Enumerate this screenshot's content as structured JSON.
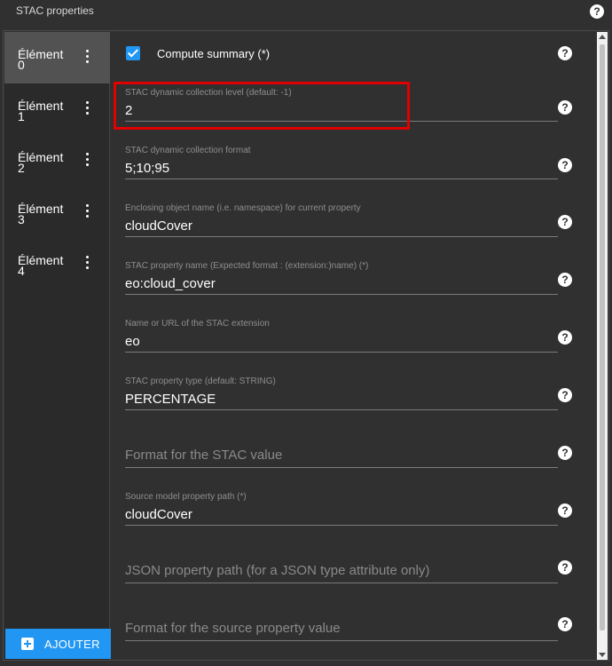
{
  "window": {
    "title": "STAC properties",
    "help_glyph": "?"
  },
  "sidebar": {
    "items": [
      {
        "label": "Élément\n0",
        "active": true
      },
      {
        "label": "Élément\n1",
        "active": false
      },
      {
        "label": "Élément\n2",
        "active": false
      },
      {
        "label": "Élément\n3",
        "active": false
      },
      {
        "label": "Élément\n4",
        "active": false
      }
    ],
    "add_button_label": "AJOUTER"
  },
  "form": {
    "compute_summary": {
      "label": "Compute summary (*)",
      "checked": true
    },
    "fields": [
      {
        "label": "STAC dynamic collection level (default: -1)",
        "value": "2",
        "placeholder": ""
      },
      {
        "label": "STAC dynamic collection format",
        "value": "5;10;95",
        "placeholder": ""
      },
      {
        "label": "Enclosing object name (i.e. namespace) for current property",
        "value": "cloudCover",
        "placeholder": ""
      },
      {
        "label": "STAC property name (Expected format : (extension:)name) (*)",
        "value": "eo:cloud_cover",
        "placeholder": ""
      },
      {
        "label": "Name or URL of the STAC extension",
        "value": "eo",
        "placeholder": ""
      },
      {
        "label": "STAC property type (default: STRING)",
        "value": "PERCENTAGE",
        "placeholder": ""
      },
      {
        "label": "",
        "value": "",
        "placeholder": "Format for the STAC value"
      },
      {
        "label": "Source model property path (*)",
        "value": "cloudCover",
        "placeholder": ""
      },
      {
        "label": "",
        "value": "",
        "placeholder": "JSON property path (for a JSON type attribute only)"
      },
      {
        "label": "",
        "value": "",
        "placeholder": "Format for the source property value"
      }
    ]
  },
  "colors": {
    "accent": "#2196f3",
    "highlight": "#e00000",
    "background": "#303030"
  }
}
